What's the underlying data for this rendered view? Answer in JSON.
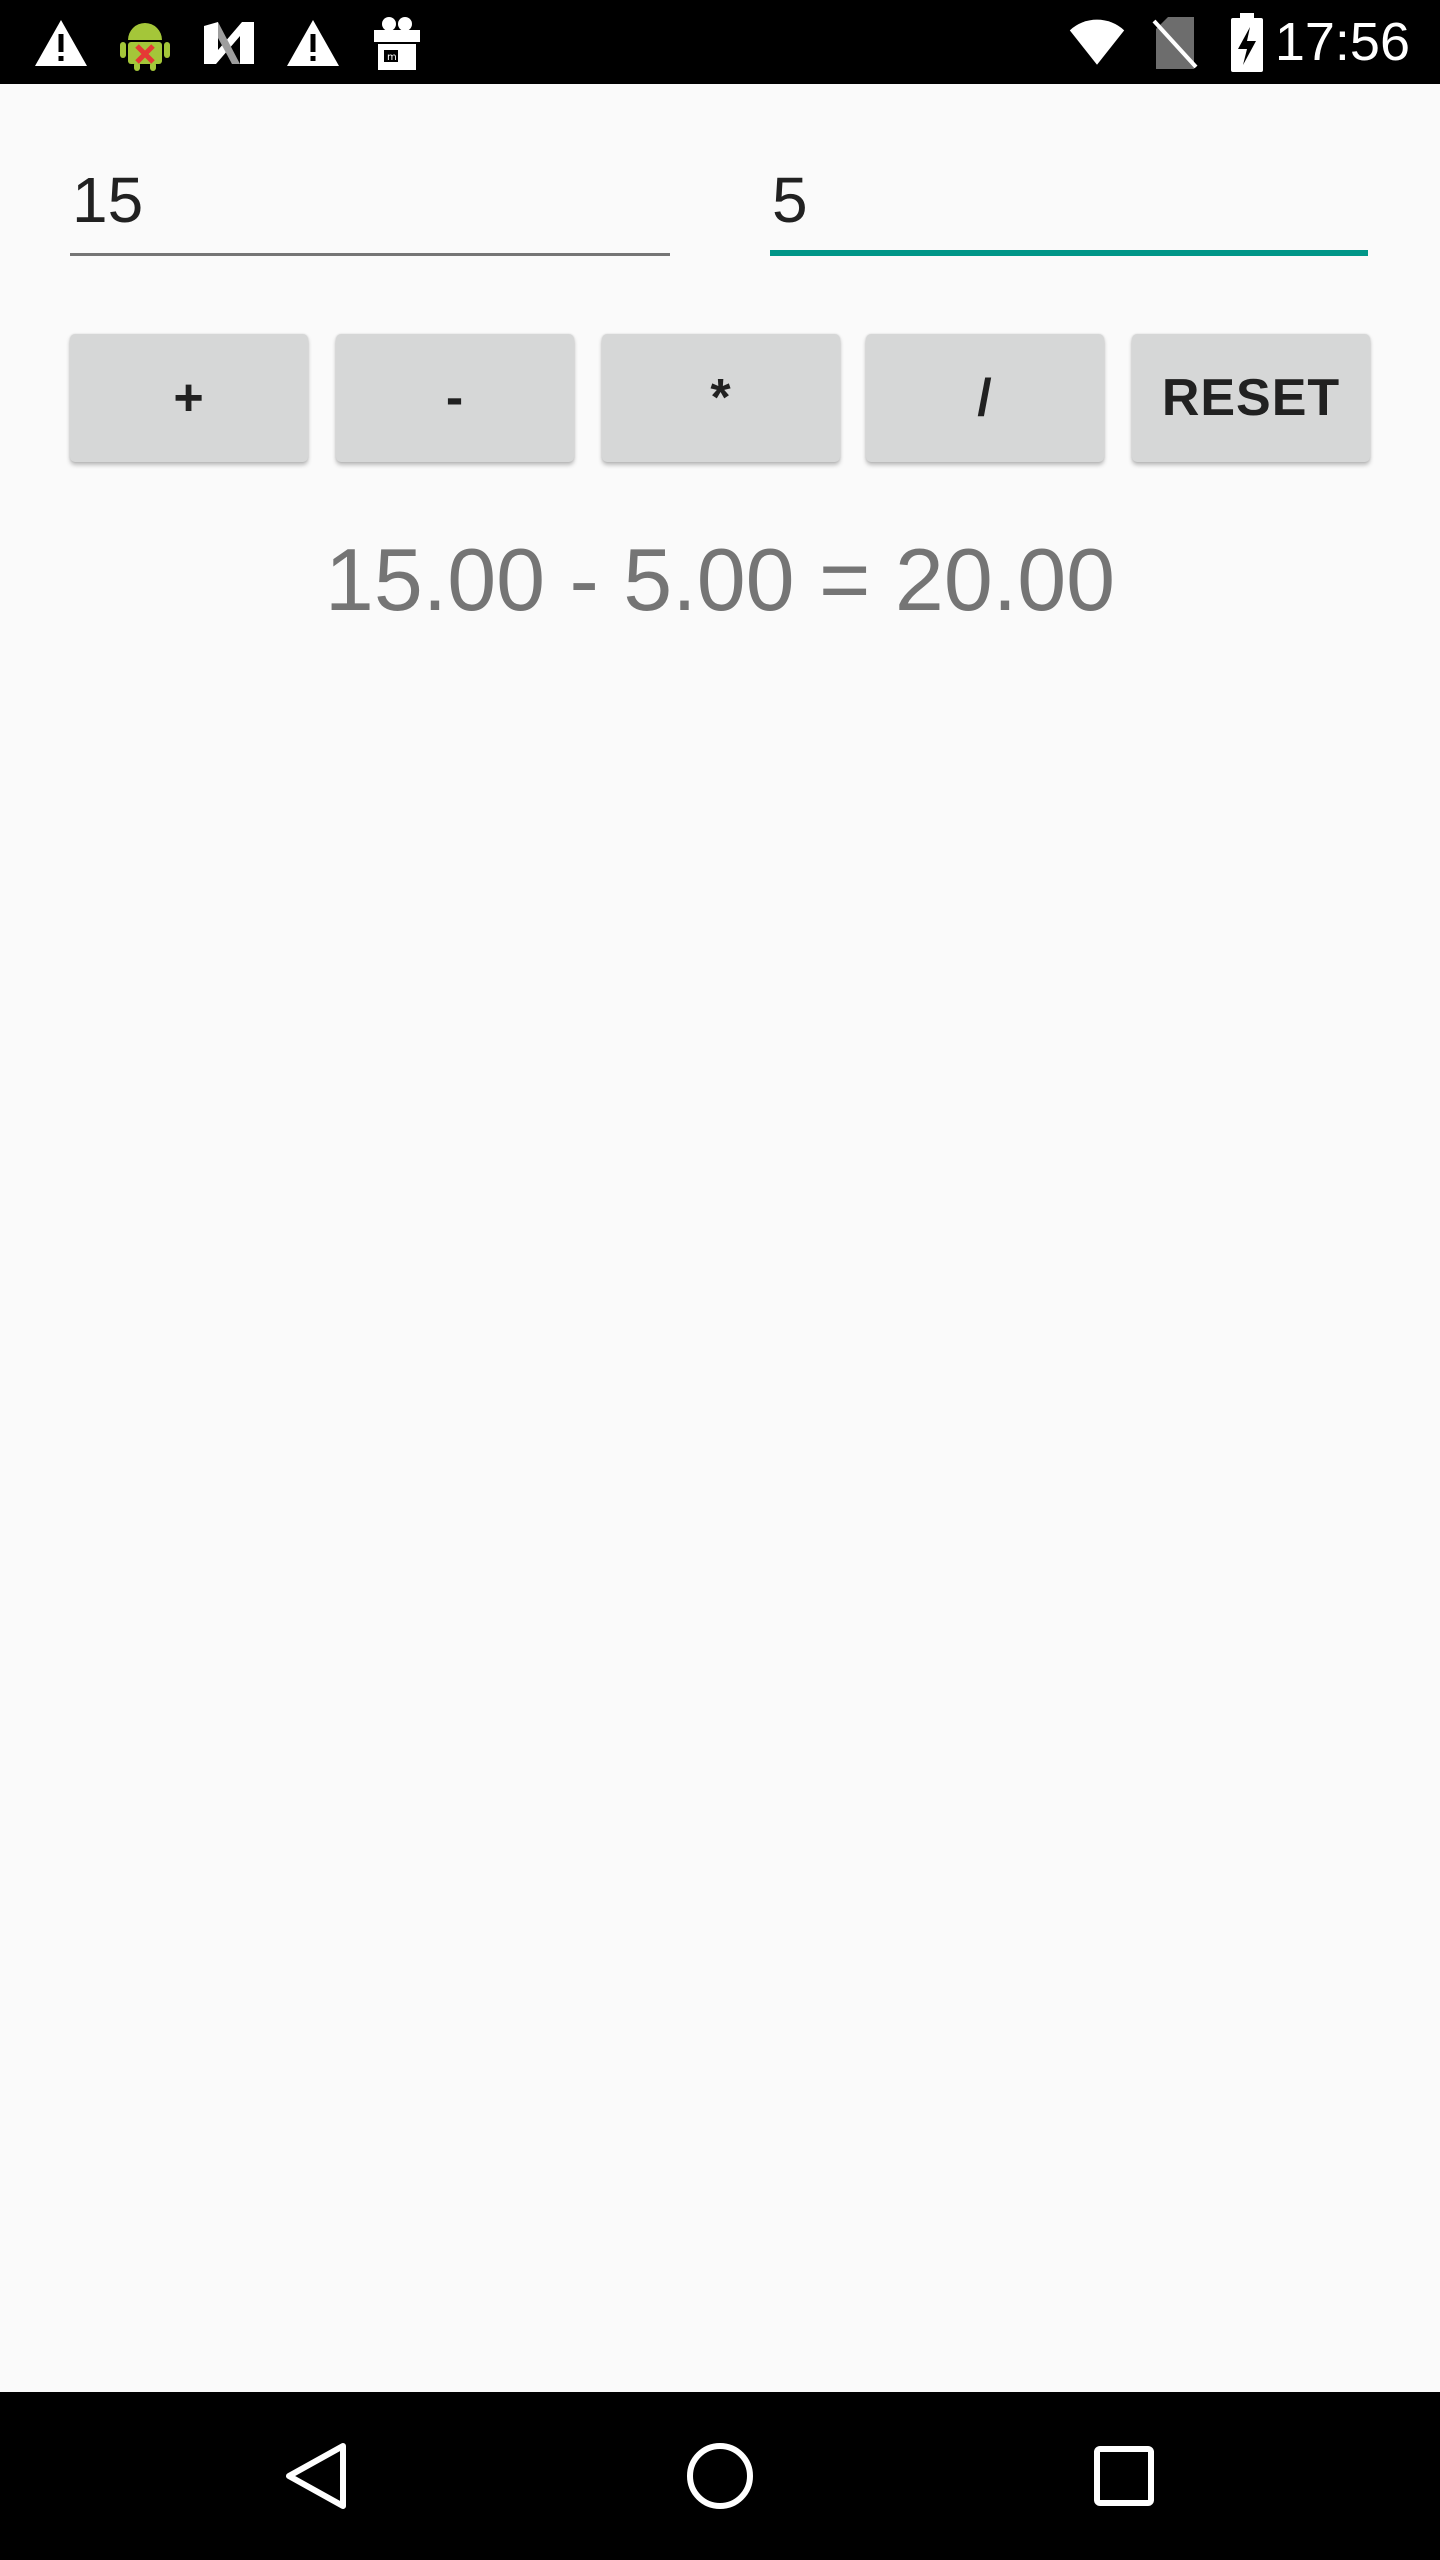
{
  "status_bar": {
    "time": "17:56",
    "left_icons": [
      "warning-icon",
      "android-debug-icon",
      "n-icon",
      "warning-icon",
      "gift-box-icon"
    ],
    "right_icons": [
      "wifi-icon",
      "no-sim-icon",
      "battery-charging-icon"
    ]
  },
  "inputs": {
    "first_value": "15",
    "second_value": "5"
  },
  "buttons": {
    "add_label": "+",
    "subtract_label": "-",
    "multiply_label": "*",
    "divide_label": "/",
    "reset_label": "RESET"
  },
  "result": {
    "text": "15.00 - 5.00 = 20.00"
  },
  "nav_bar": {
    "icons": [
      "back-icon",
      "home-icon",
      "recents-icon"
    ]
  },
  "colors": {
    "accent": "#009688",
    "button_bg": "#d6d7d7",
    "background": "#fafafa",
    "result_text": "#757575"
  }
}
